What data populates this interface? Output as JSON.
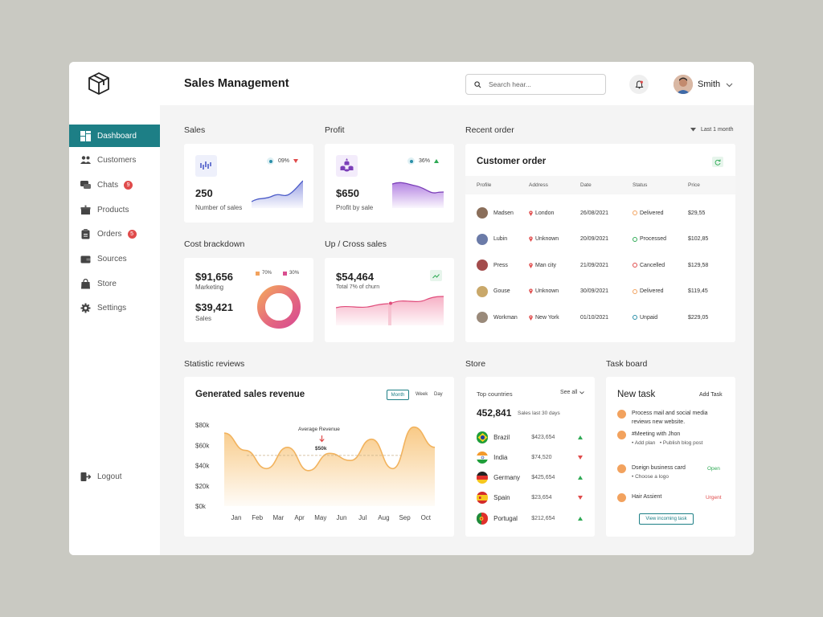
{
  "header": {
    "title": "Sales Management",
    "search_placeholder": "Search hear...",
    "user_name": "Smith"
  },
  "sidebar": {
    "items": [
      {
        "label": "Dashboard",
        "icon": "dashboard-icon",
        "active": true
      },
      {
        "label": "Customers",
        "icon": "users-icon"
      },
      {
        "label": "Chats",
        "icon": "chat-icon",
        "badge": "9"
      },
      {
        "label": "Products",
        "icon": "box-icon"
      },
      {
        "label": "Orders",
        "icon": "clipboard-icon",
        "badge": "5"
      },
      {
        "label": "Sources",
        "icon": "wallet-icon"
      },
      {
        "label": "Store",
        "icon": "bag-icon"
      },
      {
        "label": "Settings",
        "icon": "gear-icon"
      }
    ],
    "logout_label": "Logout"
  },
  "sales": {
    "section": "Sales",
    "percent": "09%",
    "value": "250",
    "label": "Number of sales",
    "trend": "down"
  },
  "profit": {
    "section": "Profit",
    "percent": "36%",
    "value": "$650",
    "label": "Profit by sale",
    "trend": "up"
  },
  "cost": {
    "section": "Cost brackdown",
    "marketing_value": "$91,656",
    "marketing_label": "Marketing",
    "sales_value": "$39,421",
    "sales_label": "Sales",
    "legend_a": "70%",
    "legend_b": "30%",
    "color_a": "#f2a25e",
    "color_b": "#d94e8f"
  },
  "upcross": {
    "section": "Up / Cross sales",
    "value": "$54,464",
    "label": "Total 7% of churn"
  },
  "recent": {
    "section": "Recent order",
    "filter": "Last 1 month",
    "card_title": "Customer order",
    "columns": [
      "Profile",
      "Address",
      "Date",
      "Status",
      "Price"
    ],
    "rows": [
      {
        "name": "Madsen",
        "address": "London",
        "date": "26/08/2021",
        "status": "Delivered",
        "status_color": "#f2a25e",
        "price": "$29,55",
        "avatar": "#8a6e5a"
      },
      {
        "name": "Lubin",
        "address": "Unknown",
        "date": "20/09/2021",
        "status": "Processed",
        "status_color": "#2faa55",
        "price": "$102,85",
        "avatar": "#6b7ba8"
      },
      {
        "name": "Press",
        "address": "Man city",
        "date": "21/09/2021",
        "status": "Cancelled",
        "status_color": "#e04b4b",
        "price": "$129,58",
        "avatar": "#a34c4c"
      },
      {
        "name": "Gouse",
        "address": "Unknown",
        "date": "30/09/2021",
        "status": "Delivered",
        "status_color": "#f2a25e",
        "price": "$119,45",
        "avatar": "#c9a86a"
      },
      {
        "name": "Workman",
        "address": "New York",
        "date": "01/10/2021",
        "status": "Unpaid",
        "status_color": "#2a8fa8",
        "price": "$229,05",
        "avatar": "#9a8a7a"
      }
    ]
  },
  "statistic": {
    "section": "Statistic reviews",
    "card_title": "Generated sales revenue",
    "tabs": [
      "Month",
      "Week",
      "Day"
    ],
    "active_tab": "Month",
    "annotation_label": "Average Revenue",
    "annotation_value": "$50k"
  },
  "chart_data": {
    "type": "area",
    "title": "Generated sales revenue",
    "categories": [
      "Jan",
      "Feb",
      "Mar",
      "Apr",
      "May",
      "Jun",
      "Jul",
      "Aug",
      "Sep",
      "Oct"
    ],
    "y_ticks": [
      "$80k",
      "$60k",
      "$40k",
      "$20k",
      "$0k"
    ],
    "ylim": [
      0,
      80000
    ],
    "average": 50000,
    "series": [
      {
        "values": [
          72000,
          55000,
          37000,
          58000,
          35000,
          52000,
          45000,
          66000,
          37000,
          78000,
          58000
        ]
      }
    ],
    "color": "#f2b35e"
  },
  "store": {
    "section": "Store",
    "subtitle": "Top countries",
    "see_all": "See all",
    "total": "452,841",
    "total_label": "Sales last 30 days",
    "countries": [
      {
        "name": "Brazil",
        "value": "$423,654",
        "trend": "up"
      },
      {
        "name": "India",
        "value": "$74,520",
        "trend": "down"
      },
      {
        "name": "Germany",
        "value": "$425,654",
        "trend": "up"
      },
      {
        "name": "Spain",
        "value": "$23,654",
        "trend": "down"
      },
      {
        "name": "Portugal",
        "value": "$212,654",
        "trend": "up"
      }
    ]
  },
  "taskboard": {
    "section": "Task board",
    "card_title": "New task",
    "add_label": "Add Task",
    "tasks": [
      {
        "title": "Process mail and social media reviews new website."
      },
      {
        "title": "#Meeting with Jhon",
        "subs": [
          "Add plan",
          "Publish blog post"
        ]
      },
      {
        "title": "Dseign business card",
        "subs": [
          "Choose a logo"
        ],
        "tag": "Open",
        "tag_color": "#2faa55"
      },
      {
        "title": "Hair Assient",
        "tag": "Urgent",
        "tag_color": "#e04b4b"
      }
    ],
    "view_button": "View incoming task"
  }
}
